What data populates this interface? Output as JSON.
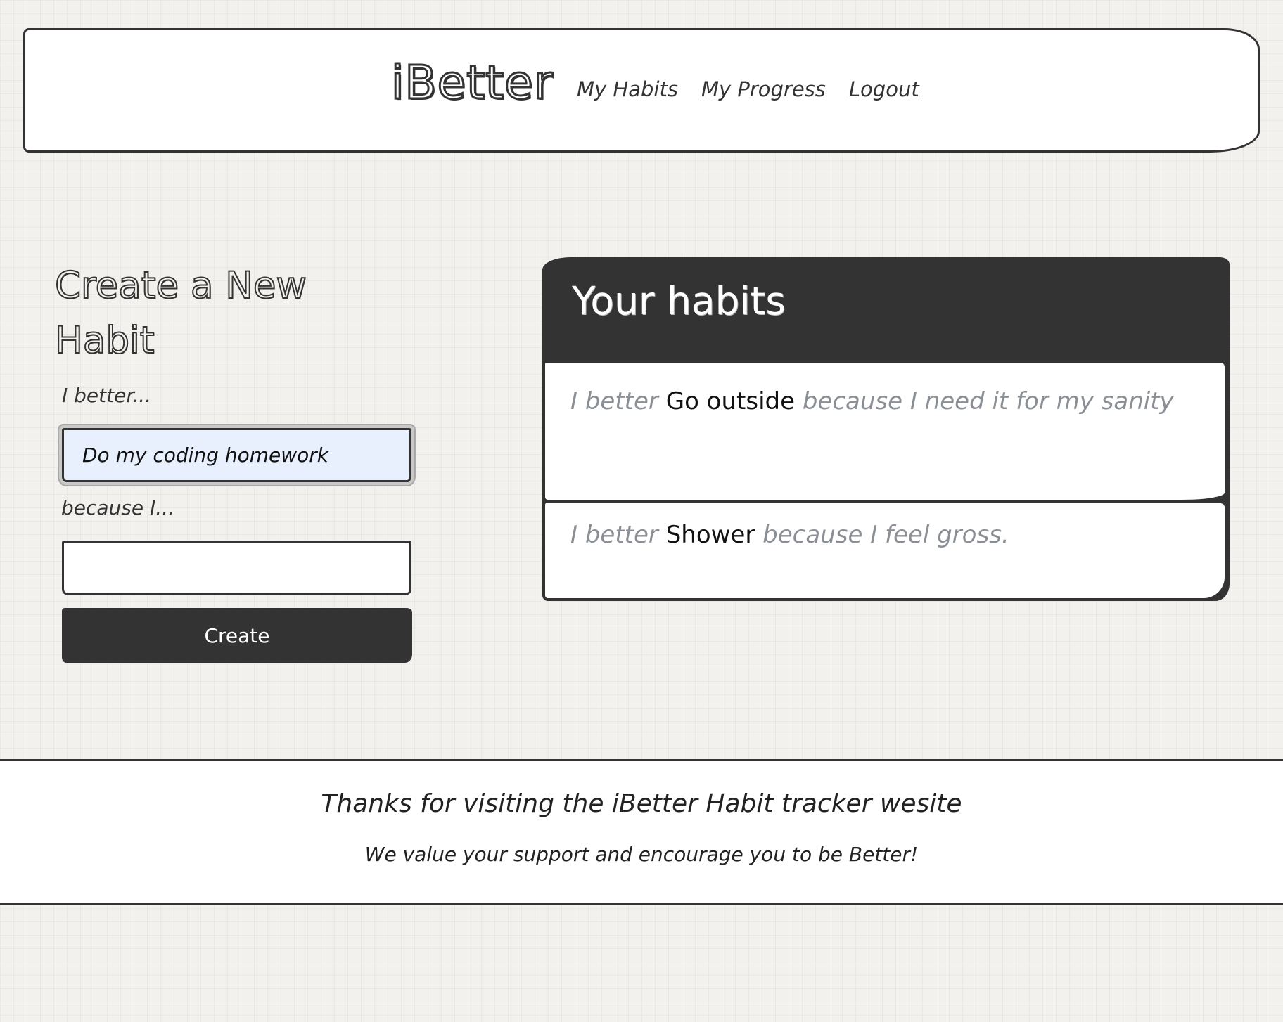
{
  "header": {
    "brand": "iBetter",
    "nav": [
      {
        "label": "My Habits"
      },
      {
        "label": "My Progress"
      },
      {
        "label": "Logout"
      }
    ]
  },
  "create_form": {
    "title": "Create a New Habit",
    "habit_label": "I better...",
    "habit_value": "Do my coding homework",
    "reason_label": "because I...",
    "reason_value": "",
    "submit_label": "Create"
  },
  "habits": {
    "heading": "Your habits",
    "prefix": "I better",
    "connector": "because",
    "items": [
      {
        "name": "Go outside",
        "reason": "I need it for my sanity"
      },
      {
        "name": "Shower",
        "reason": "I feel gross."
      }
    ]
  },
  "footer": {
    "thanks": "Thanks for visiting the iBetter Habit tracker wesite",
    "note": "We value your support and encourage you to be Better!"
  },
  "colors": {
    "ink": "#333333",
    "background": "#f3f1ee",
    "muted_text": "#8a8f96",
    "autofill": "#e8f0fe"
  }
}
